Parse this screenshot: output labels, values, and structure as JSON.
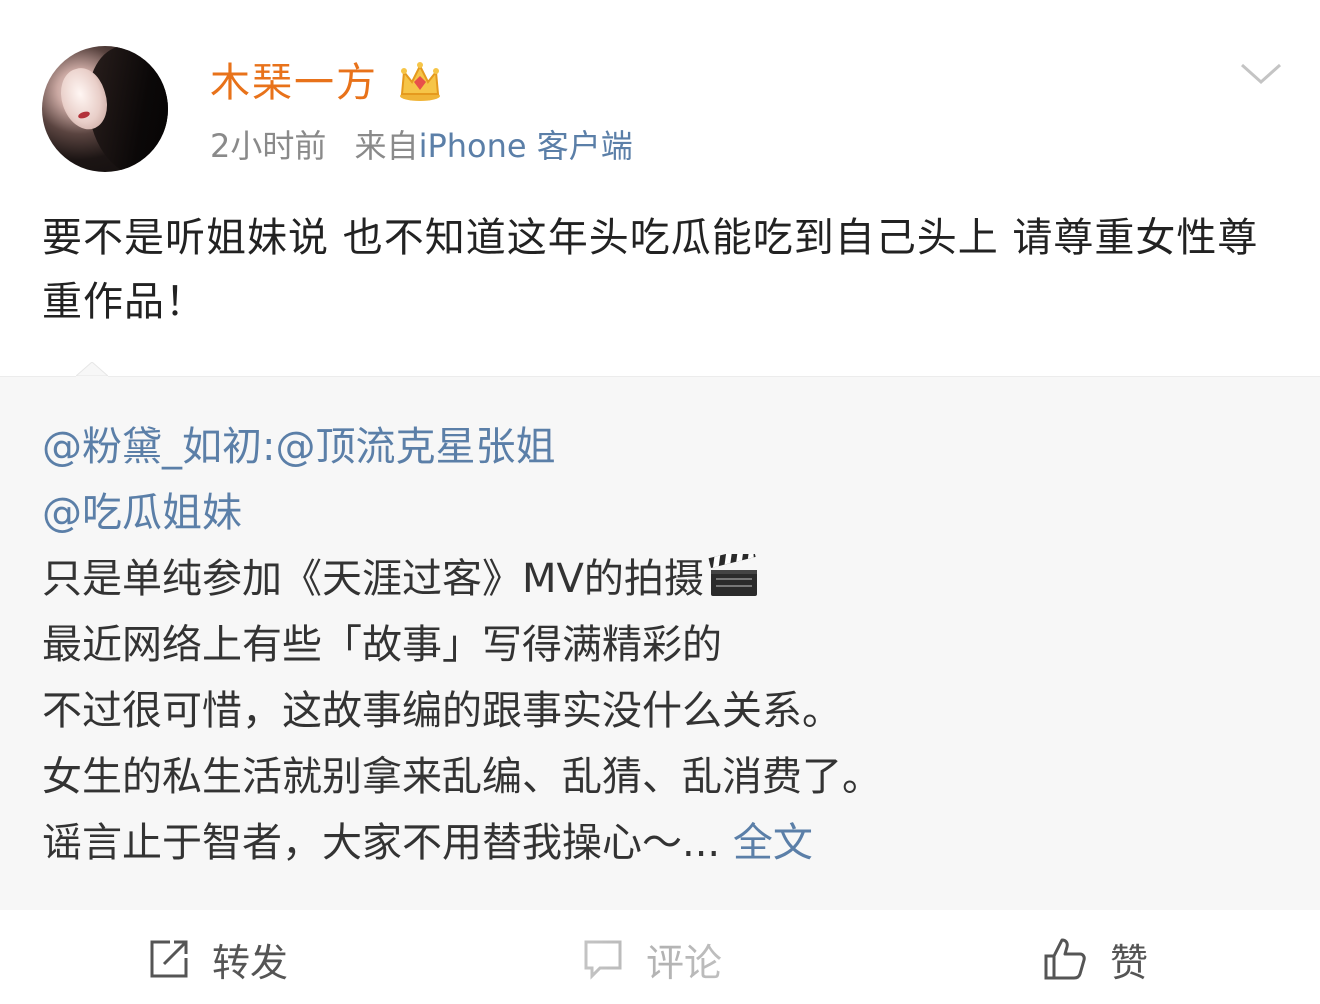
{
  "user": {
    "name": "木琹一方",
    "badge_icon": "crown-icon",
    "name_color": "#e8721a"
  },
  "meta": {
    "time": "2小时前",
    "source_prefix": "来自",
    "device": "iPhone 客户端"
  },
  "post": {
    "text": "要不是听姐妹说 也不知道这年头吃瓜能吃到自己头上 请尊重女性尊重作品！"
  },
  "repost": {
    "mention1": "@粉黛_如初",
    "colon": ":",
    "mention2": "@顶流克星张姐",
    "mention3": "@吃瓜姐妹",
    "line1": "只是单纯参加《天涯过客》MV的拍摄",
    "line1_icon": "clapperboard-icon",
    "line2": "最近网络上有些「故事」写得满精彩的",
    "line3": "不过很可惜，这故事编的跟事实没什么关系。",
    "line4": "女生的私生活就别拿来乱编、乱猜、乱消费了。",
    "line5": "谣言止于智者，大家不用替我操心～...",
    "full_text_link": "全文"
  },
  "actions": {
    "forward": "转发",
    "comment": "评论",
    "like": "赞"
  },
  "colors": {
    "link": "#5b7fa8",
    "repost_bg": "#f7f7f7",
    "meta": "#8a8a8a"
  }
}
